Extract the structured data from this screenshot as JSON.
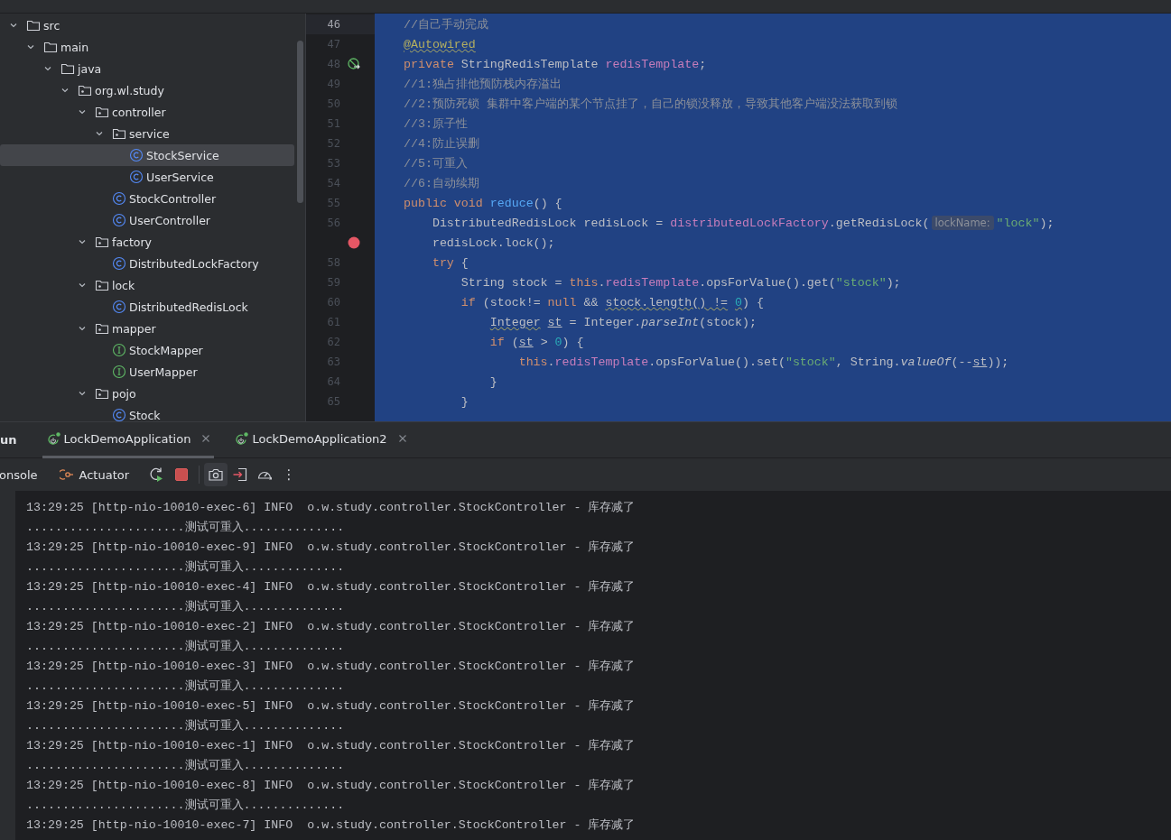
{
  "project_tree": {
    "items": [
      {
        "label": "src",
        "kind": "folder",
        "expanded": true,
        "selected": false,
        "children": [
          {
            "label": "main",
            "kind": "folder",
            "expanded": true,
            "selected": false,
            "children": [
              {
                "label": "java",
                "kind": "folder",
                "expanded": true,
                "selected": false,
                "children": [
                  {
                    "label": "org.wl.study",
                    "kind": "package",
                    "expanded": true,
                    "selected": false,
                    "children": [
                      {
                        "label": "controller",
                        "kind": "package",
                        "expanded": true,
                        "selected": false,
                        "children": [
                          {
                            "label": "service",
                            "kind": "package",
                            "expanded": true,
                            "selected": false,
                            "children": [
                              {
                                "label": "StockService",
                                "kind": "class",
                                "selected": true
                              },
                              {
                                "label": "UserService",
                                "kind": "class",
                                "selected": false
                              }
                            ]
                          },
                          {
                            "label": "StockController",
                            "kind": "class",
                            "selected": false
                          },
                          {
                            "label": "UserController",
                            "kind": "class",
                            "selected": false
                          }
                        ]
                      },
                      {
                        "label": "factory",
                        "kind": "package",
                        "expanded": true,
                        "selected": false,
                        "children": [
                          {
                            "label": "DistributedLockFactory",
                            "kind": "class",
                            "selected": false
                          }
                        ]
                      },
                      {
                        "label": "lock",
                        "kind": "package",
                        "expanded": true,
                        "selected": false,
                        "children": [
                          {
                            "label": "DistributedRedisLock",
                            "kind": "class",
                            "selected": false
                          }
                        ]
                      },
                      {
                        "label": "mapper",
                        "kind": "package",
                        "expanded": true,
                        "selected": false,
                        "children": [
                          {
                            "label": "StockMapper",
                            "kind": "interface",
                            "selected": false
                          },
                          {
                            "label": "UserMapper",
                            "kind": "interface",
                            "selected": false
                          }
                        ]
                      },
                      {
                        "label": "pojo",
                        "kind": "package",
                        "expanded": true,
                        "selected": false,
                        "children": [
                          {
                            "label": "Stock",
                            "kind": "class",
                            "selected": false
                          }
                        ]
                      }
                    ]
                  }
                ]
              }
            ]
          }
        ]
      }
    ]
  },
  "editor": {
    "lines": [
      {
        "number": "46",
        "current": true,
        "tokens": [
          {
            "kind": "comment",
            "text": "//自己手动完成"
          }
        ]
      },
      {
        "number": "47",
        "current": false,
        "tokens": [
          {
            "kind": "annotation",
            "text": "@Autowired",
            "wavy": true
          }
        ]
      },
      {
        "number": "48",
        "current": false,
        "marker": {
          "kind": "bean"
        },
        "tokens": [
          {
            "kind": "keyword",
            "text": "private"
          },
          {
            "kind": "plain",
            "text": " StringRedisTemplate "
          },
          {
            "kind": "field",
            "text": "redisTemplate"
          },
          {
            "kind": "plain",
            "text": ";"
          }
        ]
      },
      {
        "number": "49",
        "current": false,
        "tokens": [
          {
            "kind": "comment",
            "text": "//1:独占排他预防栈内存溢出"
          }
        ]
      },
      {
        "number": "50",
        "current": false,
        "tokens": [
          {
            "kind": "comment",
            "text": "//2:预防死锁 集群中客户端的某个节点挂了，自己的锁没释放，导致其他客户端没法获取到锁"
          }
        ]
      },
      {
        "number": "51",
        "current": false,
        "tokens": [
          {
            "kind": "comment",
            "text": "//3:原子性"
          }
        ]
      },
      {
        "number": "52",
        "current": false,
        "tokens": [
          {
            "kind": "comment",
            "text": "//4:防止误删"
          }
        ]
      },
      {
        "number": "53",
        "current": false,
        "tokens": [
          {
            "kind": "comment",
            "text": "//5:可重入"
          }
        ]
      },
      {
        "number": "54",
        "current": false,
        "tokens": [
          {
            "kind": "comment",
            "text": "//6:自动续期"
          }
        ]
      },
      {
        "number": "55",
        "current": false,
        "tokens": [
          {
            "kind": "keyword",
            "text": "public void "
          },
          {
            "kind": "method",
            "text": "reduce"
          },
          {
            "kind": "plain",
            "text": "() {"
          }
        ],
        "children": [
          {
            "number": "56",
            "current": false,
            "tokens": [
              {
                "kind": "plain",
                "text": "DistributedRedisLock redisLock = "
              },
              {
                "kind": "field",
                "text": "distributedLockFactory"
              },
              {
                "kind": "plain",
                "text": ".getRedisLock("
              },
              {
                "kind": "hint",
                "text": "lockName:"
              },
              {
                "kind": "string",
                "text": "\"lock\""
              },
              {
                "kind": "plain",
                "text": ");"
              }
            ]
          },
          {
            "current": false,
            "marker": {
              "kind": "breakpoint"
            },
            "tokens": [
              {
                "kind": "plain",
                "text": "redisLock.lock();"
              }
            ]
          },
          {
            "number": "58",
            "current": false,
            "tokens": [
              {
                "kind": "keyword",
                "text": "try"
              },
              {
                "kind": "plain",
                "text": " {"
              }
            ],
            "children": [
              {
                "number": "59",
                "current": false,
                "tokens": [
                  {
                    "kind": "plain",
                    "text": "String stock = "
                  },
                  {
                    "kind": "keyword",
                    "text": "this"
                  },
                  {
                    "kind": "plain",
                    "text": "."
                  },
                  {
                    "kind": "field",
                    "text": "redisTemplate"
                  },
                  {
                    "kind": "plain",
                    "text": ".opsForValue().get("
                  },
                  {
                    "kind": "string",
                    "text": "\"stock\""
                  },
                  {
                    "kind": "plain",
                    "text": ");"
                  }
                ]
              },
              {
                "number": "60",
                "current": false,
                "tokens": [
                  {
                    "kind": "keyword",
                    "text": "if"
                  },
                  {
                    "kind": "plain",
                    "text": " (stock!= "
                  },
                  {
                    "kind": "keyword",
                    "text": "null"
                  },
                  {
                    "kind": "plain",
                    "text": " && "
                  },
                  {
                    "kind": "plain",
                    "text": "stock.length() != ",
                    "wavy": true
                  },
                  {
                    "kind": "number",
                    "text": "0",
                    "wavy": true
                  },
                  {
                    "kind": "plain",
                    "text": ") {"
                  }
                ],
                "children": [
                  {
                    "number": "61",
                    "current": false,
                    "tokens": [
                      {
                        "kind": "plain",
                        "text": "Integer",
                        "wavy": true
                      },
                      {
                        "kind": "plain",
                        "text": " st",
                        "underline": true
                      },
                      {
                        "kind": "plain",
                        "text": " = Integer."
                      },
                      {
                        "kind": "static",
                        "text": "parseInt"
                      },
                      {
                        "kind": "plain",
                        "text": "(stock);"
                      }
                    ]
                  },
                  {
                    "number": "62",
                    "current": false,
                    "tokens": [
                      {
                        "kind": "keyword",
                        "text": "if"
                      },
                      {
                        "kind": "plain",
                        "text": " ("
                      },
                      {
                        "kind": "plain",
                        "text": "st",
                        "underline": true
                      },
                      {
                        "kind": "plain",
                        "text": " > "
                      },
                      {
                        "kind": "number",
                        "text": "0"
                      },
                      {
                        "kind": "plain",
                        "text": ") {"
                      }
                    ],
                    "children": [
                      {
                        "number": "63",
                        "current": false,
                        "tokens": [
                          {
                            "kind": "keyword",
                            "text": "this"
                          },
                          {
                            "kind": "plain",
                            "text": "."
                          },
                          {
                            "kind": "field",
                            "text": "redisTemplate"
                          },
                          {
                            "kind": "plain",
                            "text": ".opsForValue().set("
                          },
                          {
                            "kind": "string",
                            "text": "\"stock\""
                          },
                          {
                            "kind": "plain",
                            "text": ", String."
                          },
                          {
                            "kind": "static",
                            "text": "valueOf"
                          },
                          {
                            "kind": "plain",
                            "text": "(--"
                          },
                          {
                            "kind": "plain",
                            "text": "st",
                            "underline": true
                          },
                          {
                            "kind": "plain",
                            "text": "));"
                          }
                        ]
                      }
                    ]
                  },
                  {
                    "number": "64",
                    "current": false,
                    "tokens": [
                      {
                        "kind": "plain",
                        "text": "}"
                      }
                    ]
                  }
                ]
              },
              {
                "number": "65",
                "current": false,
                "tokens": [
                  {
                    "kind": "plain",
                    "text": "}"
                  }
                ]
              }
            ]
          }
        ]
      }
    ]
  },
  "run_panel": {
    "title": "un",
    "tabs": [
      {
        "label": "LockDemoApplication",
        "selected": true
      },
      {
        "label": "LockDemoApplication2",
        "selected": false
      }
    ],
    "toolbar": [
      {
        "kind": "tab",
        "label": "onsole"
      },
      {
        "kind": "tab",
        "label": "Actuator"
      },
      {
        "kind": "rerun"
      },
      {
        "kind": "stop"
      },
      {
        "kind": "sep"
      },
      {
        "kind": "camera",
        "selected": true
      },
      {
        "kind": "exit"
      },
      {
        "kind": "gauge"
      },
      {
        "kind": "more",
        "label": "⋮"
      }
    ],
    "console": [
      "13:29:25 [http-nio-10010-exec-6] INFO  o.w.study.controller.StockController - 库存减了",
      "......................测试可重入..............",
      "13:29:25 [http-nio-10010-exec-9] INFO  o.w.study.controller.StockController - 库存减了",
      "......................测试可重入..............",
      "13:29:25 [http-nio-10010-exec-4] INFO  o.w.study.controller.StockController - 库存减了",
      "......................测试可重入..............",
      "13:29:25 [http-nio-10010-exec-2] INFO  o.w.study.controller.StockController - 库存减了",
      "......................测试可重入..............",
      "13:29:25 [http-nio-10010-exec-3] INFO  o.w.study.controller.StockController - 库存减了",
      "......................测试可重入..............",
      "13:29:25 [http-nio-10010-exec-5] INFO  o.w.study.controller.StockController - 库存减了",
      "......................测试可重入..............",
      "13:29:25 [http-nio-10010-exec-1] INFO  o.w.study.controller.StockController - 库存减了",
      "......................测试可重入..............",
      "13:29:25 [http-nio-10010-exec-8] INFO  o.w.study.controller.StockController - 库存减了",
      "......................测试可重入..............",
      "13:29:25 [http-nio-10010-exec-7] INFO  o.w.study.controller.StockController - 库存减了"
    ]
  }
}
